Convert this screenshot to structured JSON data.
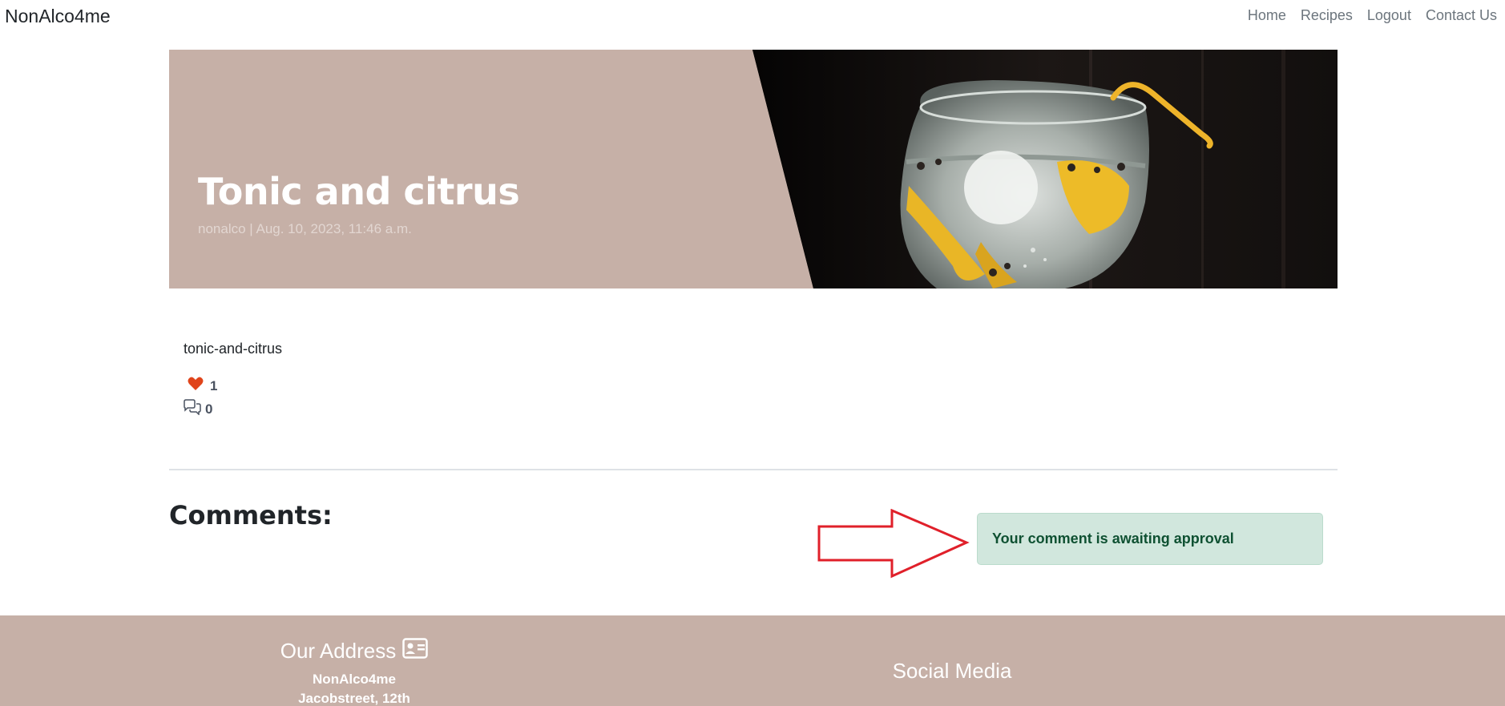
{
  "navbar": {
    "brand": "NonAlco4me",
    "links": [
      "Home",
      "Recipes",
      "Logout",
      "Contact Us"
    ]
  },
  "hero": {
    "title": "Tonic and citrus",
    "meta": "nonalco | Aug. 10, 2023, 11:46 a.m.",
    "image_icon": "gin-tonic-glass-photo"
  },
  "post": {
    "slug": "tonic-and-citrus",
    "likes": "1",
    "comments": "0",
    "like_icon": "heart-icon",
    "comment_icon": "speech-bubbles-icon"
  },
  "comments": {
    "heading": "Comments:",
    "alert": "Your comment is awaiting approval",
    "annotation_icon": "red-arrow-outline"
  },
  "footer": {
    "address_heading": "Our Address",
    "address_icon": "id-card-icon",
    "address_lines": [
      "NonAlco4me",
      "Jacobstreet, 12th"
    ],
    "social_heading": "Social Media"
  },
  "colors": {
    "hero_bg": "#c6b0a7",
    "footer_bg": "#c6b0a7",
    "alert_bg": "#d1e7dd",
    "alert_text": "#0f5132",
    "heart": "#e0441b",
    "arrow": "#e0202a"
  }
}
